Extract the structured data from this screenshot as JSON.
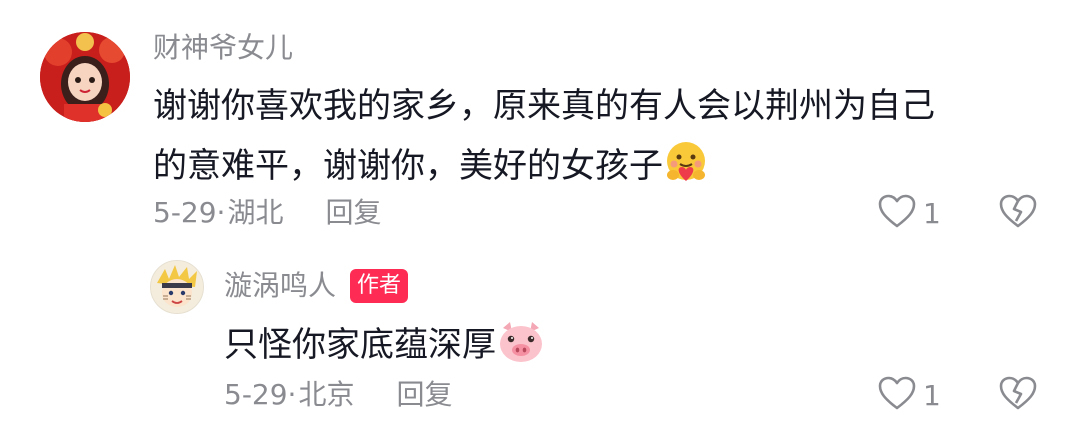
{
  "comments": [
    {
      "username": "财神爷女儿",
      "content_line1": "谢谢你喜欢我的家乡，原来真的有人会以荆州为自己",
      "content_line2": "的意难平，谢谢你，美好的女孩子",
      "emoji": "hug-emoji",
      "date": "5-29",
      "separator": "·",
      "location": "湖北",
      "reply_label": "回复",
      "like_count": "1"
    },
    {
      "username": "漩涡鸣人",
      "badge": "作者",
      "content": "只怪你家底蕴深厚",
      "emoji": "pig-emoji",
      "date": "5-29",
      "separator": "·",
      "location": "北京",
      "reply_label": "回复",
      "like_count": "1"
    }
  ],
  "colors": {
    "secondary_text": "#8a8b91",
    "primary_text": "#161823",
    "author_badge": "#fe2c55"
  }
}
